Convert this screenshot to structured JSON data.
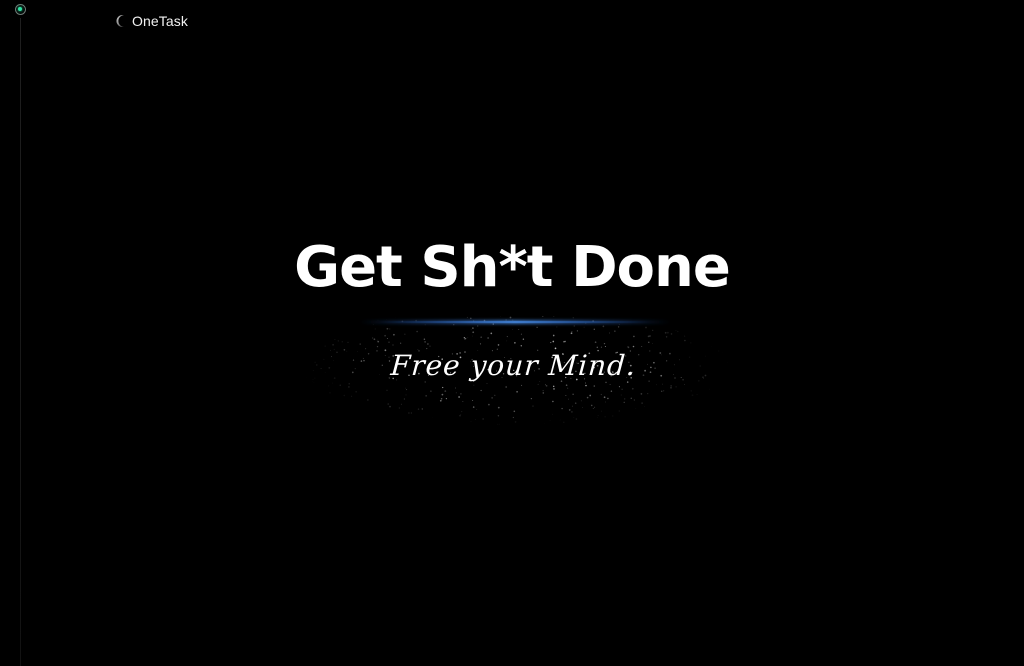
{
  "brand": {
    "name": "OneTask",
    "logo_icon": "crescent-moon-icon"
  },
  "status_indicator": {
    "icon": "active-dot-icon",
    "color": "#2fe3a3"
  },
  "hero": {
    "headline": "Get Sh*t Done",
    "tagline": "Free your Mind.",
    "accent_color": "#2f7dff"
  }
}
